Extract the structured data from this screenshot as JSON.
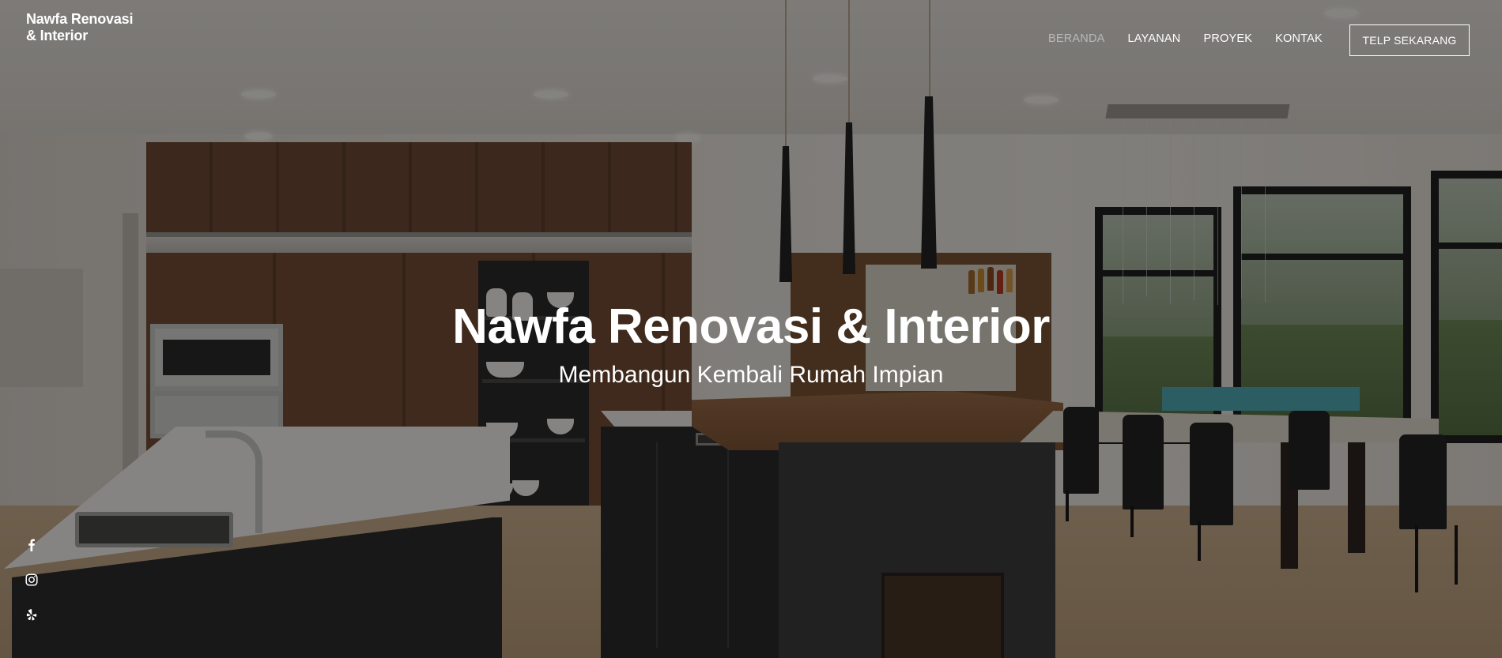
{
  "header": {
    "brand": "Nawfa Renovasi & Interior",
    "nav": [
      {
        "label": "BERANDA",
        "active": true
      },
      {
        "label": "LAYANAN",
        "active": false
      },
      {
        "label": "PROYEK",
        "active": false
      },
      {
        "label": "KONTAK",
        "active": false
      }
    ],
    "cta_label": "TELP SEKARANG"
  },
  "hero": {
    "title": "Nawfa Renovasi & Interior",
    "subtitle": "Membangun Kembali Rumah Impian",
    "background": "kitchen-interior-photo"
  },
  "social": [
    {
      "icon": "facebook-icon"
    },
    {
      "icon": "instagram-icon"
    },
    {
      "icon": "yelp-icon"
    }
  ],
  "colors": {
    "nav_active": "#b8b8b8",
    "text": "#ffffff",
    "overlay": "rgba(0,0,0,0.45)"
  }
}
